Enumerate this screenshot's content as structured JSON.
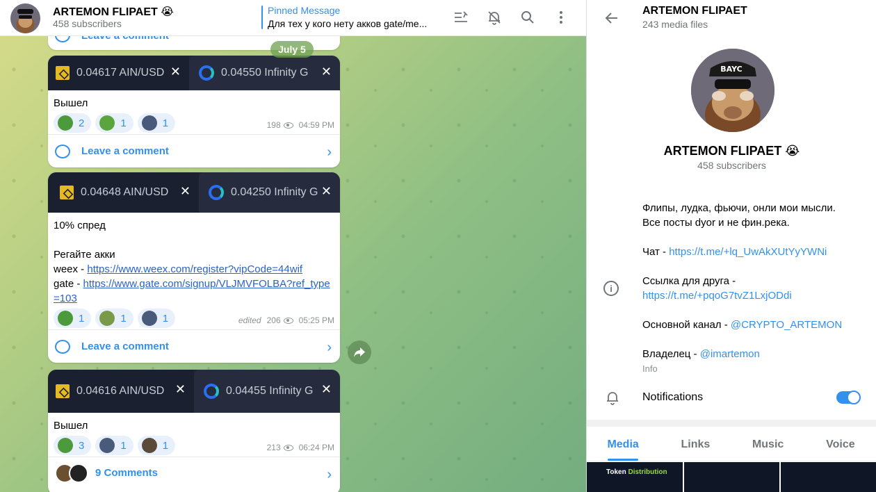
{
  "header": {
    "title": "ARTEMON FLIPAET 😭",
    "subscribers": "458 subscribers",
    "pinned_title": "Pinned Message",
    "pinned_text": "Для тех у кого нету акков gate/me..."
  },
  "date_pill": "July 5",
  "posts": [
    {
      "tab_left": "0.04617 AIN/USD",
      "tab_right": "0.04550 Infinity G",
      "text": "Вышел",
      "reactions": [
        "2",
        "1",
        "1"
      ],
      "views": "198",
      "time": "04:59 PM",
      "comment_label": "Leave a comment"
    },
    {
      "tab_left": "0.04648 AIN/USD",
      "tab_right": "0.04250 Infinity G",
      "text_line1": "10% спред",
      "text_line2": "Регайте акки",
      "weex_prefix": "weex - ",
      "weex_link": "https://www.weex.com/register?vipCode=44wif",
      "gate_prefix": "gate - ",
      "gate_link": "https://www.gate.com/signup/VLJMVFOLBA?ref_type=103",
      "reactions": [
        "1",
        "1",
        "1"
      ],
      "edited": "edited",
      "views": "206",
      "time": "05:25 PM",
      "comment_label": "Leave a comment"
    },
    {
      "tab_left": "0.04616 AIN/USD",
      "tab_right": "0.04455 Infinity G",
      "text": "Вышел",
      "reactions": [
        "3",
        "1",
        "1"
      ],
      "views": "213",
      "time": "06:24 PM",
      "comment_label": "9 Comments"
    }
  ],
  "profile": {
    "title": "ARTEMON FLIPAET",
    "media_files": "243 media files",
    "name": "ARTEMON FLIPAET 😭",
    "subscribers": "458 subscribers",
    "desc_line1": "Флипы, лудка, фьючи, онли мои мысли.",
    "desc_line2": "Все посты dyor и не фин.река.",
    "chat_prefix": "Чат - ",
    "chat_link": "https://t.me/+lq_UwAkXUtYyYWNi",
    "friend_prefix": "Ссылка для друга - ",
    "friend_link": "https://t.me/+pqoG7tvZ1LxjODdi",
    "main_prefix": "Основной канал - ",
    "main_link": "@CRYPTO_ARTEMON",
    "owner_prefix": "Владелец - ",
    "owner_link": "@imartemon",
    "info_label": "Info",
    "notifications_label": "Notifications",
    "notifications_on": true,
    "tabs": [
      "Media",
      "Links",
      "Music",
      "Voice"
    ],
    "media_thumb_text_a": "Token ",
    "media_thumb_text_b": "Distribution"
  },
  "colors": {
    "accent": "#3390ec",
    "chart_dark": "#1f2535"
  }
}
